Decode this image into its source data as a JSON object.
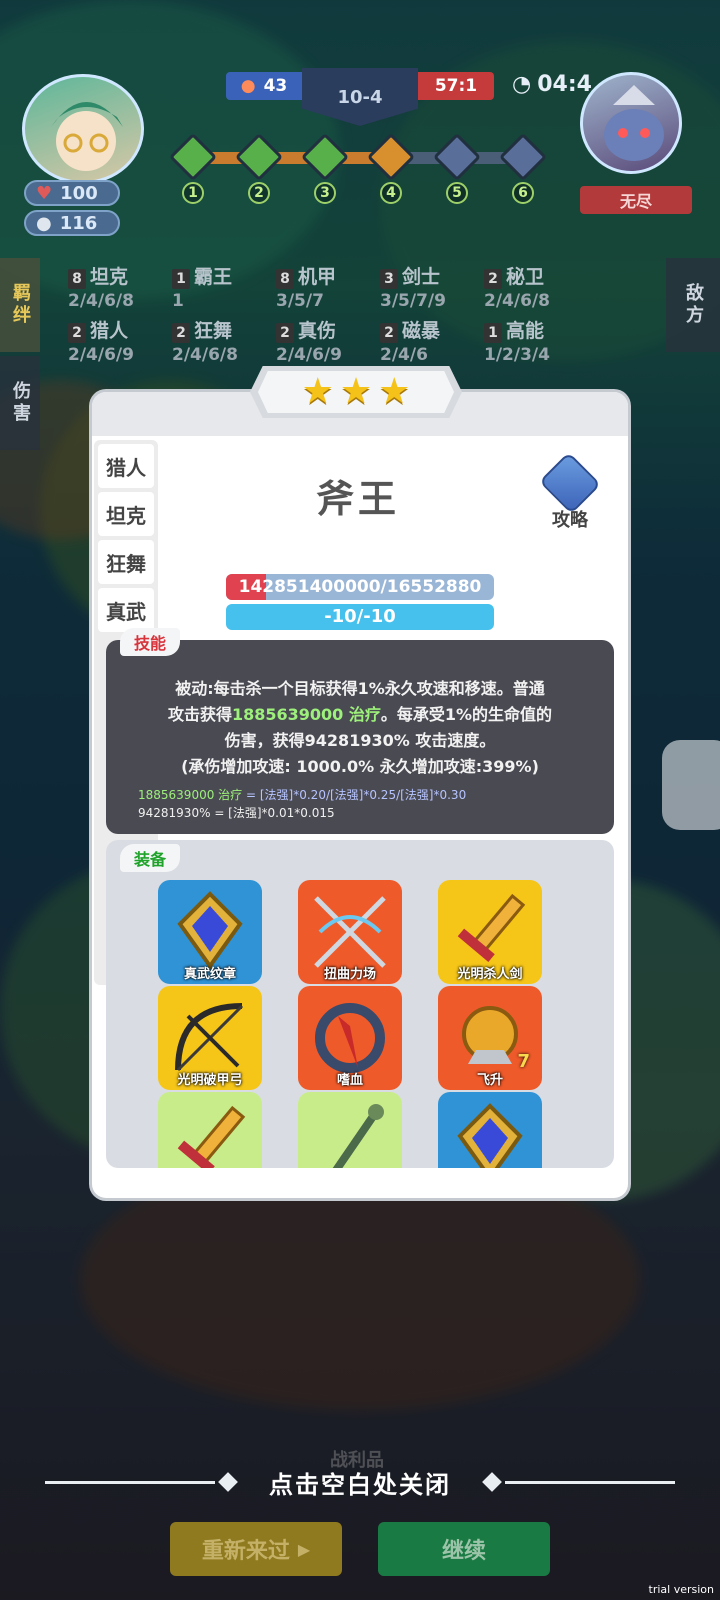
{
  "hud": {
    "player_hp": "100",
    "player_gold": "116",
    "left_score": "43",
    "round": "10-4",
    "right_score": "57:1",
    "timer": "04:4",
    "mode_badge": "无尽",
    "stages": [
      "1",
      "2",
      "3",
      "4",
      "5",
      "6"
    ],
    "stage_progress": 0.62
  },
  "side_tabs": {
    "left_active": "羁绊",
    "left_other": "伤害",
    "right": "敌方"
  },
  "synergies": [
    {
      "count": "8",
      "name": "坦克",
      "levels": "2/4/6/8"
    },
    {
      "count": "1",
      "name": "霸王",
      "levels": "1"
    },
    {
      "count": "8",
      "name": "机甲",
      "levels": "3/5/7"
    },
    {
      "count": "3",
      "name": "剑士",
      "levels": "3/5/7/9"
    },
    {
      "count": "2",
      "name": "秘卫",
      "levels": "2/4/6/8"
    },
    {
      "count": "2",
      "name": "猎人",
      "levels": "2/4/6/9"
    },
    {
      "count": "2",
      "name": "狂舞",
      "levels": "2/4/6/8"
    },
    {
      "count": "2",
      "name": "真伤",
      "levels": "2/4/6/9"
    },
    {
      "count": "2",
      "name": "磁暴",
      "levels": "2/4/6"
    },
    {
      "count": "1",
      "name": "高能",
      "levels": "1/2/3/4"
    }
  ],
  "modal": {
    "star_count": 3,
    "class_tabs": [
      "猎人",
      "坦克",
      "狂舞",
      "真武"
    ],
    "hero_name": "斧王",
    "guide_label": "攻略",
    "hp_text": "142851400000/16552880",
    "hp_fill_fraction": 0.15,
    "stat_text": "-10/-10",
    "skill": {
      "label": "技能",
      "line1": "被动:每击杀一个目标获得1%永久攻速和移速。普通",
      "line2_pre": "攻击获得",
      "line2_hl": "1885639000 治疗",
      "line2_post": "。每承受1%的生命值的",
      "line3": "伤害，获得94281930% 攻击速度。",
      "line4": "(承伤增加攻速: 1000.0% 永久增加攻速:399%)",
      "formula1_value": "1885639000 治疗",
      "formula1_expr": "= [法强]*0.20/[法强]*0.25/[法强]*0.30",
      "formula2_value": "94281930%",
      "formula2_expr": "= [法强]*0.01*0.015"
    },
    "equipment": {
      "label": "装备",
      "items": [
        {
          "name": "真武纹章",
          "color": "#2f93d6",
          "icon": "badge-icon",
          "count": ""
        },
        {
          "name": "扭曲力场",
          "color": "#ef5a2a",
          "icon": "crossbow-icon",
          "count": ""
        },
        {
          "name": "光明杀人剑",
          "color": "#f5c518",
          "icon": "sword-icon",
          "count": ""
        },
        {
          "name": "光明破甲弓",
          "color": "#f5c518",
          "icon": "bow-icon",
          "count": ""
        },
        {
          "name": "嗜血",
          "color": "#ef5a2a",
          "icon": "blade-ring-icon",
          "count": ""
        },
        {
          "name": "飞升",
          "color": "#ef5a2a",
          "icon": "orb-icon",
          "count": "7"
        },
        {
          "name": "",
          "color": "#c8ec8a",
          "icon": "sword-icon",
          "count": ""
        },
        {
          "name": "",
          "color": "#c8ec8a",
          "icon": "staff-icon",
          "count": ""
        },
        {
          "name": "",
          "color": "#2f93d6",
          "icon": "badge-icon",
          "count": ""
        }
      ]
    }
  },
  "bottom": {
    "faded_title": "战利品",
    "close_hint": "点击空白处关闭",
    "retry_label": "重新来过",
    "continue_label": "继续"
  },
  "watermark": "trial version"
}
